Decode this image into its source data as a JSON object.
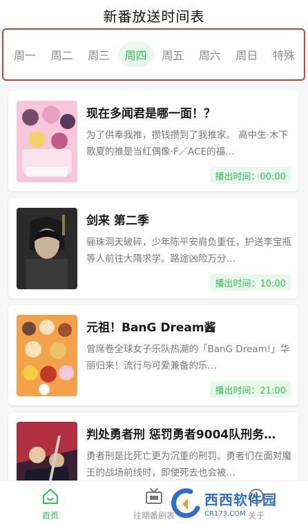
{
  "header": {
    "title": "新番放送时间表"
  },
  "day_tabs": [
    {
      "label": "周一",
      "active": false
    },
    {
      "label": "周二",
      "active": false
    },
    {
      "label": "周三",
      "active": false
    },
    {
      "label": "周四",
      "active": true
    },
    {
      "label": "周五",
      "active": false
    },
    {
      "label": "周六",
      "active": false
    },
    {
      "label": "周日",
      "active": false
    },
    {
      "label": "特殊",
      "active": false
    }
  ],
  "anime_list": [
    {
      "title": "现在多闻君是哪一面！？",
      "description": "为了供奉我推，攒钱攒到了我推家。 高中生·木下歌夏的推是当红偶像·F／ACE的福…",
      "air_time": "播出时间：00:00"
    },
    {
      "title": "剑来 第二季",
      "description": "骊珠洞天破碎，少年陈平安肩负重任，护送李宝瓶等人前往大隋求学。路途凶险万分…",
      "air_time": "播出时间：10:00"
    },
    {
      "title": "元祖！BanG Dream酱",
      "description": "曾席卷全球女子乐队热潮的「BanG Dream!」华丽归来！流行与可爱兼备的乐…",
      "air_time": "播出时间：21:00"
    },
    {
      "title": "判处勇者刑 惩罚勇者9004队刑务…",
      "description": "勇者刑是比死亡更为沉重的刑罚。勇者们在面对魔王的战场前线时，即使死去也会被…",
      "air_time": ""
    }
  ],
  "bottom_nav": {
    "home_label": "首页",
    "past_label": "往期番剧表",
    "about_label": "关于"
  },
  "watermark": {
    "main": "西西软件园",
    "sub": "CR173.COM"
  },
  "colors": {
    "accent": "#2fbf54",
    "accent_bg": "#e8f8ea",
    "highlight_border": "#e03a3a",
    "watermark_blue": "#2d6fd1"
  }
}
